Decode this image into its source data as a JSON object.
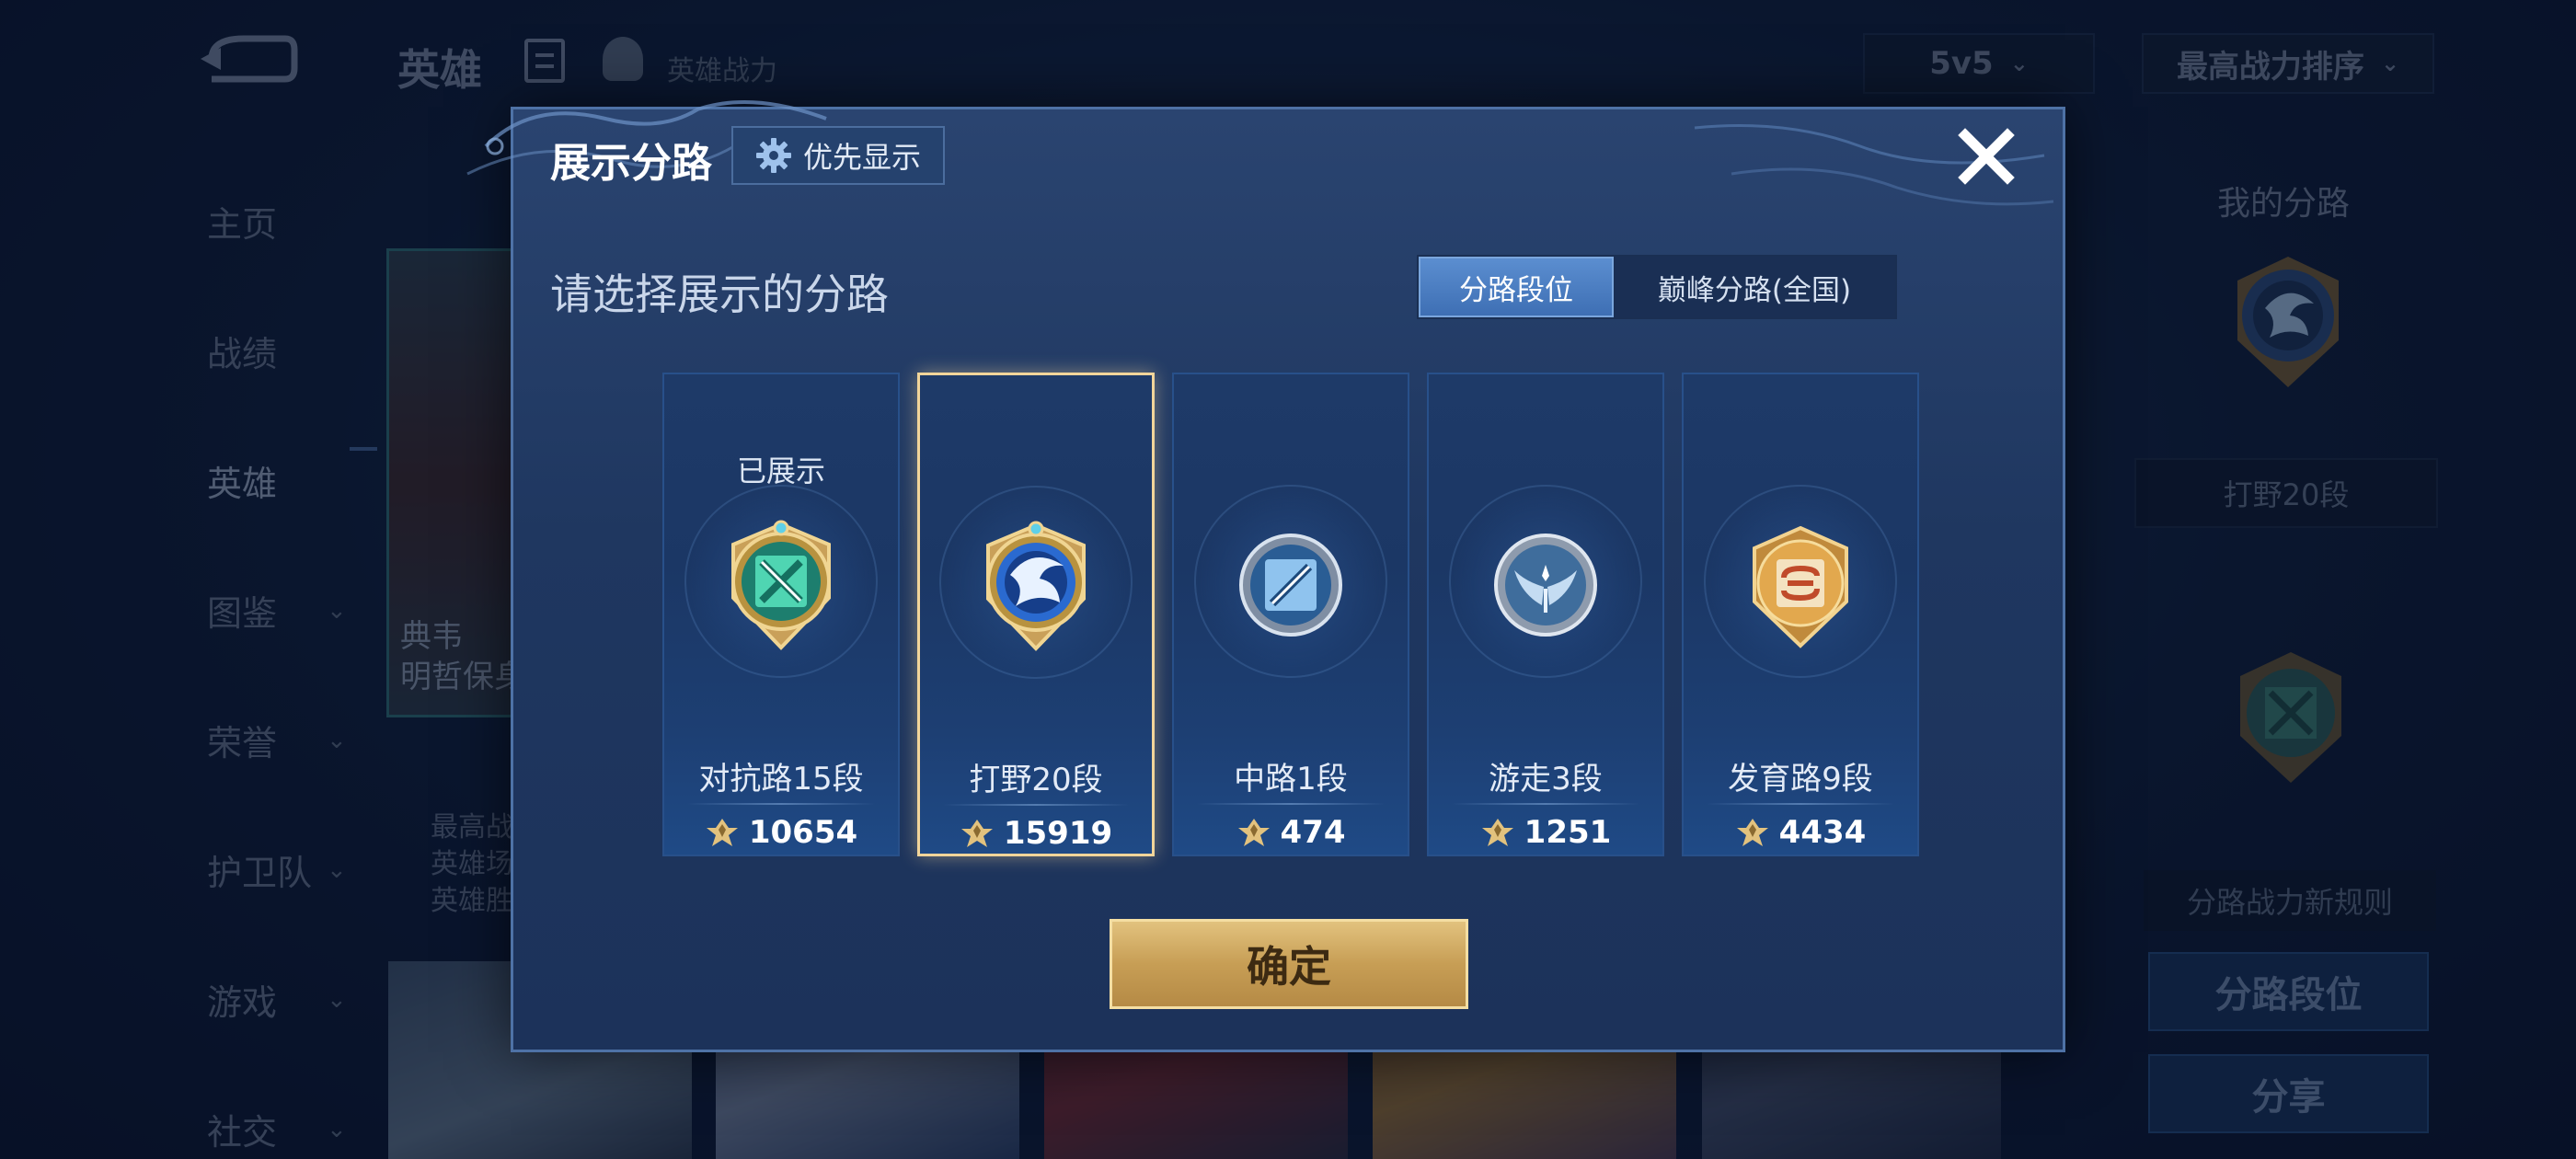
{
  "background": {
    "title": "英雄",
    "power_label": "英雄战力",
    "mode_select": "5v5",
    "sort_select": "最高战力排序",
    "nav": [
      {
        "label": "主页"
      },
      {
        "label": "战绩"
      },
      {
        "label": "英雄"
      },
      {
        "label": "图鉴"
      },
      {
        "label": "荣誉"
      },
      {
        "label": "护卫队"
      },
      {
        "label": "游戏"
      },
      {
        "label": "社交"
      }
    ],
    "hero_name_line1": "典韦",
    "hero_name_line2": "明哲保身",
    "hero_stat_1": "最高战",
    "hero_stat_2": "英雄场",
    "hero_stat_3": "英雄胜",
    "right_title": "我的分路",
    "right_pill": "打野20段",
    "rule_button": "分路战力新规则",
    "lane_rank_button": "分路段位",
    "share_button": "分享"
  },
  "modal": {
    "title": "展示分路",
    "priority_button": "优先显示",
    "subtitle": "请选择展示的分路",
    "segments": [
      {
        "label": "分路段位",
        "active": true
      },
      {
        "label": "巅峰分路(全国)",
        "active": false
      }
    ],
    "lanes": [
      {
        "top_label": "已展示",
        "name": "对抗路15段",
        "power": "10654",
        "badge": "clash-lane-badge-icon",
        "color": "#3fc8a8"
      },
      {
        "top_label": "",
        "name": "打野20段",
        "power": "15919",
        "badge": "jungle-dragon-badge-icon",
        "color": "#4c8fe0",
        "selected": true
      },
      {
        "top_label": "",
        "name": "中路1段",
        "power": "474",
        "badge": "mid-lane-badge-icon",
        "color": "#8fbde8"
      },
      {
        "top_label": "",
        "name": "游走3段",
        "power": "1251",
        "badge": "roam-wings-badge-icon",
        "color": "#a9c6e6"
      },
      {
        "top_label": "",
        "name": "发育路9段",
        "power": "4434",
        "badge": "farm-lane-badge-icon",
        "color": "#e0a24a"
      }
    ],
    "confirm_button": "确定",
    "accent_gold": "#e2c27e"
  }
}
